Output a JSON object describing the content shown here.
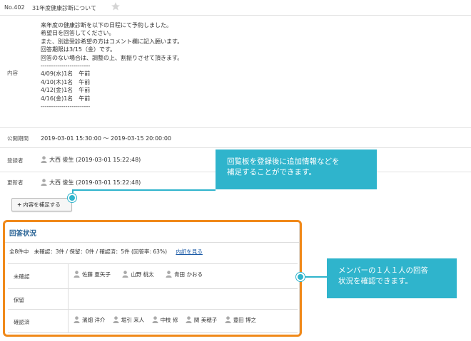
{
  "header": {
    "number": "No.402",
    "title": "31年度健康診断について"
  },
  "content": {
    "label": "内容",
    "lines": [
      "来年度の健康診断を以下の日程にて予約しました。",
      "希望日を回答してください。",
      "また、別途受診希望の方はコメント欄に記入願います。",
      "回答期限は3/15（金）です。",
      "回答のない場合は、調整の上、割振りさせて頂きます。",
      "------------------------",
      "4/09(水)1名　午前",
      "4/10(木)1名　午前",
      "4/12(金)1名　午前",
      "4/16(金)1名　午前",
      "------------------------"
    ]
  },
  "period": {
    "label": "公開期間",
    "value": "2019-03-01 15:30:00 ～ 2019-03-15 20:00:00"
  },
  "registrant": {
    "label": "登録者",
    "name": "大西 俊生",
    "time": "(2019-03-01 15:22:48)"
  },
  "updater": {
    "label": "更新者",
    "name": "大西 俊生",
    "time": "(2019-03-01 15:22:48)"
  },
  "add_button": {
    "label": "内容を補足する"
  },
  "answers": {
    "title": "回答状況",
    "summary": "全8件中　未確認：3件 / 保留：0件 / 確認済：5件 (回答率: 63%)",
    "detail_link": "内訳を見る",
    "rows": [
      {
        "label": "未確認",
        "names": [
          "佐藤 亜矢子",
          "山野 桃太",
          "青田 かおる"
        ]
      },
      {
        "label": "保留",
        "names": []
      },
      {
        "label": "確認済",
        "names": [
          "濱畑 洋介",
          "堀引 来人",
          "中枝 修",
          "関 美穂子",
          "豊田 博之"
        ]
      }
    ]
  },
  "callouts": {
    "first": [
      "回覧板を登録後に追加情報などを",
      "補足することができます。"
    ],
    "second": [
      "メンバーの１人１人の回答",
      "状況を確認できます。"
    ]
  },
  "colors": {
    "accent": "#2fb4cc",
    "highlight": "#f0891a",
    "title_blue": "#2a6496"
  }
}
